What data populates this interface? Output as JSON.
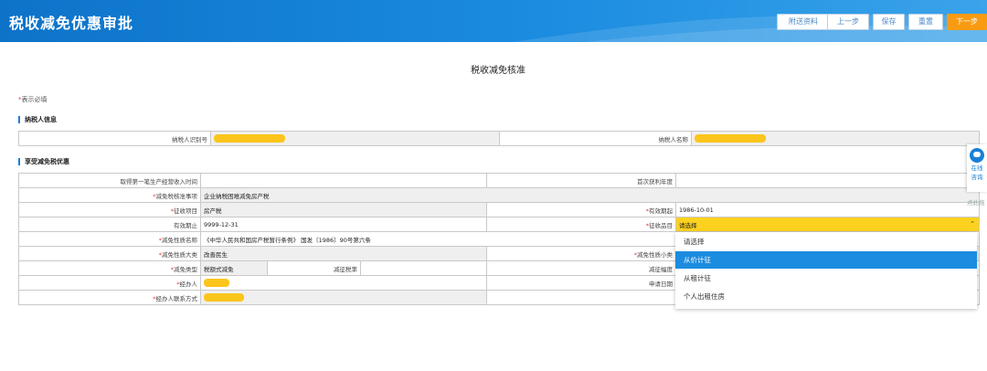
{
  "header": {
    "title": "税收减免优惠审批",
    "buttons": {
      "attach": "附送资料",
      "prev": "上一步",
      "save": "保存",
      "reset": "重置",
      "next": "下一步"
    }
  },
  "page_title": "税收减免核准",
  "required_note": {
    "star": "*",
    "text": "表示必填"
  },
  "taxpayer_section": {
    "title": "纳税人信息",
    "id_label": "纳税人识别号",
    "name_label": "纳税人名称"
  },
  "relief_section": {
    "title": "享受减免税优惠",
    "rows": {
      "first_income_time_label": "取得第一笔生产经营收入时间",
      "first_profit_year_label": "首次获利年度",
      "item_label": "减免税核准事项",
      "item_value": "企业纳税困难减免房产税",
      "levy_item_label": "征收项目",
      "levy_item_value": "房产税",
      "valid_from_label": "有效期起",
      "valid_from_value": "1986-10-01",
      "valid_to_label": "有效期止",
      "valid_to_value": "9999-12-31",
      "levy_subitem_label": "征收品目",
      "levy_subitem_value": "请选择",
      "nature_name_label": "减免性质名称",
      "nature_name_value": "《中华人民共和国房产税暂行条例》 国发〔1986〕90号第六条",
      "nature_major_label": "减免性质大类",
      "nature_major_value": "改善民生",
      "nature_minor_label": "减免性质小类",
      "type_label": "减免类型",
      "type_value": "税额式减免",
      "levy_rate_label": "减征税率",
      "levy_range_label": "减征幅度",
      "handler_label": "经办人",
      "apply_date_label": "申请日期",
      "contact_label": "经办人联系方式"
    }
  },
  "dropdown": {
    "options": [
      "请选择",
      "从价计征",
      "从租计征",
      "个人出租住房"
    ],
    "highlighted": "从价计征"
  },
  "side_widget": {
    "line1": "在线",
    "line2": "咨询",
    "below": "点此拖"
  },
  "colors": {
    "header": "#1b8ce0",
    "primary_button": "#f99b12",
    "mask": "#fcc51c",
    "select_bg": "#fcd21f"
  }
}
